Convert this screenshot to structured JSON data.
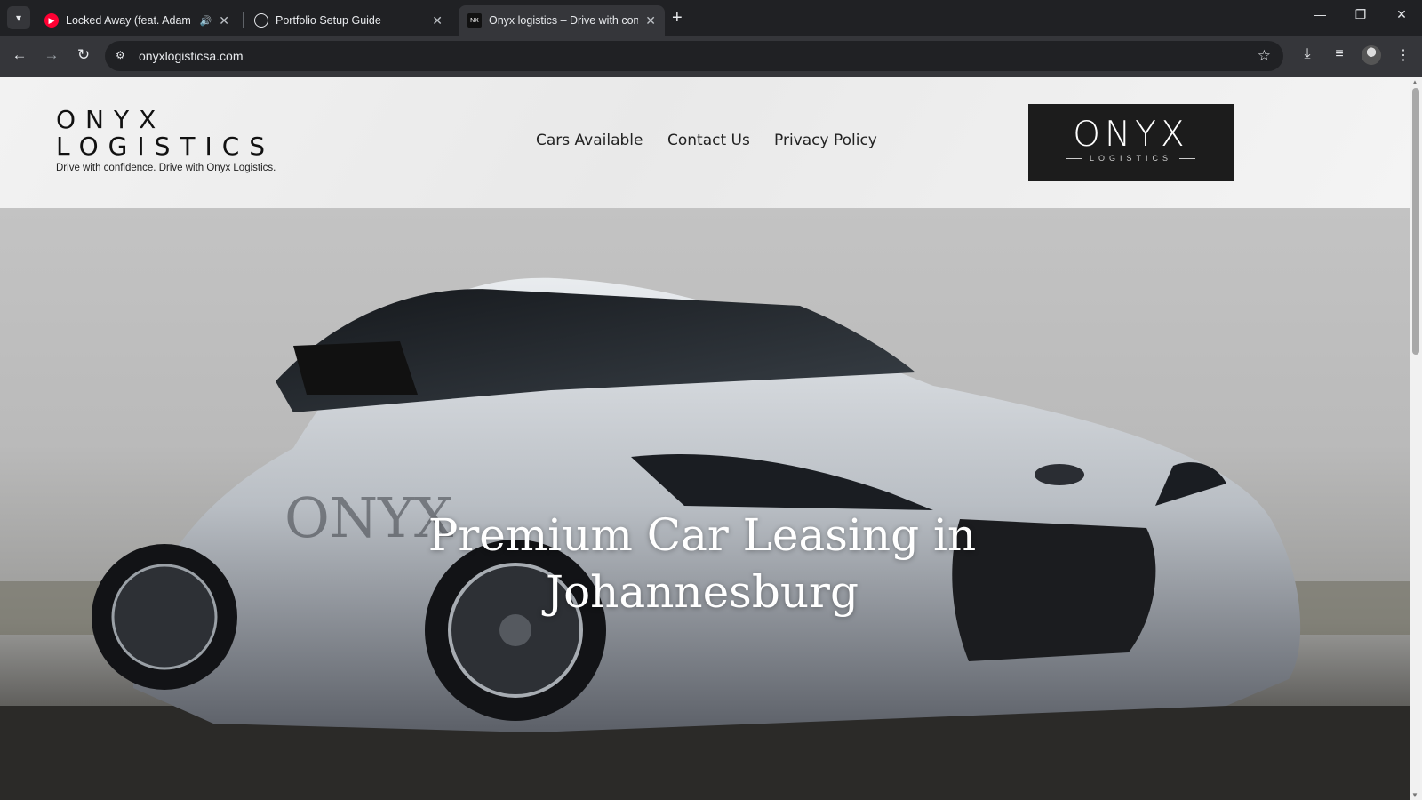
{
  "browser": {
    "tabs": [
      {
        "title": "Locked Away (feat. Adam Le",
        "icon": "youtube-music-icon",
        "audio": true
      },
      {
        "title": "Portfolio Setup Guide",
        "icon": "chatgpt-icon"
      },
      {
        "title": "Onyx logistics – Drive with conf",
        "icon": "onyx-favicon-icon",
        "active": true
      }
    ],
    "url": "onyxlogisticsa.com"
  },
  "site": {
    "brand_line1": "ONYX",
    "brand_line2": "LOGISTICS",
    "tagline": "Drive with confidence. Drive with Onyx Logistics.",
    "nav": [
      "Cars Available",
      "Contact Us",
      "Privacy Policy"
    ],
    "logo_word": "ONYX",
    "logo_sub": "LOGISTICS",
    "car_badge": "ONYX",
    "hero_title_line1": "Premium Car Leasing in",
    "hero_title_line2": "Johannesburg"
  },
  "colors": {
    "chrome_bg": "#202124",
    "toolbar_bg": "#35363a",
    "logo_bg": "#1c1c1c",
    "youtube_red": "#ff0033"
  }
}
